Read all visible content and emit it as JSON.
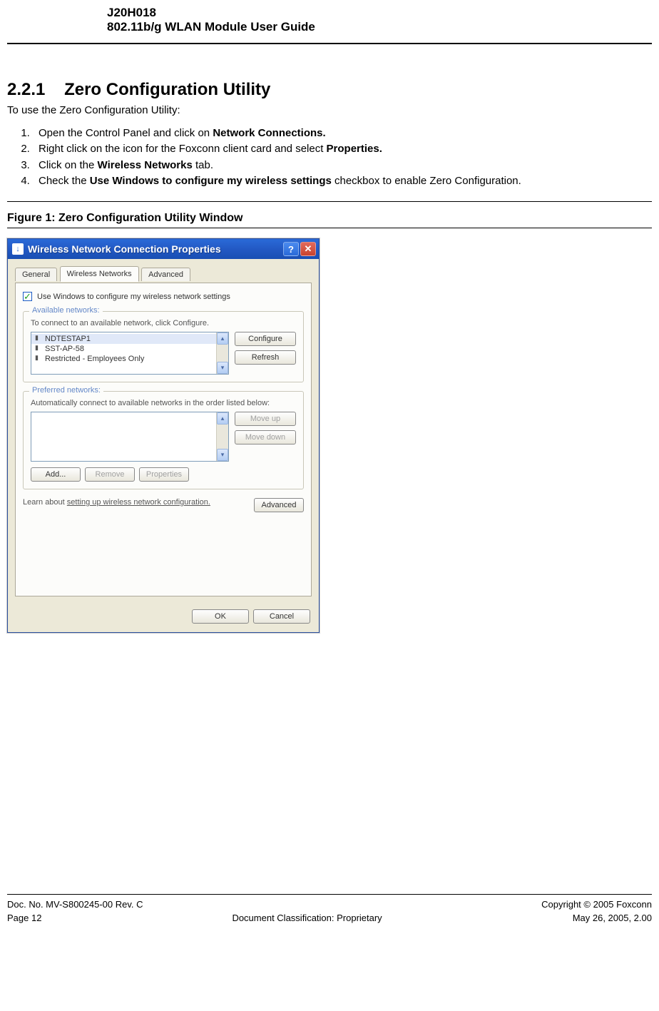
{
  "header": {
    "line1": "J20H018",
    "line2": "802.11b/g WLAN Module User Guide"
  },
  "section": {
    "number": "2.2.1",
    "title": "Zero Configuration Utility",
    "intro": "To use the Zero Configuration Utility:",
    "steps": [
      {
        "pre": "Open the Control Panel and click on ",
        "bold": "Network Connections.",
        "post": ""
      },
      {
        "pre": "Right click on the icon for the Foxconn client card and select ",
        "bold": "Properties.",
        "post": ""
      },
      {
        "pre": "Click on the ",
        "bold": "Wireless Networks",
        "post": " tab."
      },
      {
        "pre": "Check the ",
        "bold": "Use Windows to configure my wireless settings",
        "post": " checkbox to enable Zero Configuration."
      }
    ],
    "figure_caption": "Figure 1:   Zero Configuration Utility Window"
  },
  "dialog": {
    "title": "Wireless Network Connection Properties",
    "tabs": {
      "general": "General",
      "wireless": "Wireless Networks",
      "advanced": "Advanced"
    },
    "use_windows_label": "Use Windows to configure my wireless network settings",
    "use_windows_checked": true,
    "available": {
      "legend": "Available networks:",
      "hint": "To connect to an available network, click Configure.",
      "items": [
        "NDTESTAP1",
        "SST-AP-58",
        "Restricted - Employees Only"
      ],
      "configure": "Configure",
      "refresh": "Refresh"
    },
    "preferred": {
      "legend": "Preferred networks:",
      "hint": "Automatically connect to available networks in the order listed below:",
      "moveup": "Move up",
      "movedown": "Move down",
      "add": "Add...",
      "remove": "Remove",
      "properties": "Properties"
    },
    "learn": {
      "prefix": "Learn about ",
      "link": "setting up wireless network configuration.",
      "advanced": "Advanced"
    },
    "buttons": {
      "ok": "OK",
      "cancel": "Cancel"
    }
  },
  "footer": {
    "docno": "Doc. No. MV-S800245-00 Rev. C",
    "copyright": "Copyright © 2005 Foxconn",
    "page": "Page 12",
    "classification": "Document Classification: Proprietary",
    "date": "May 26, 2005, 2.00"
  }
}
